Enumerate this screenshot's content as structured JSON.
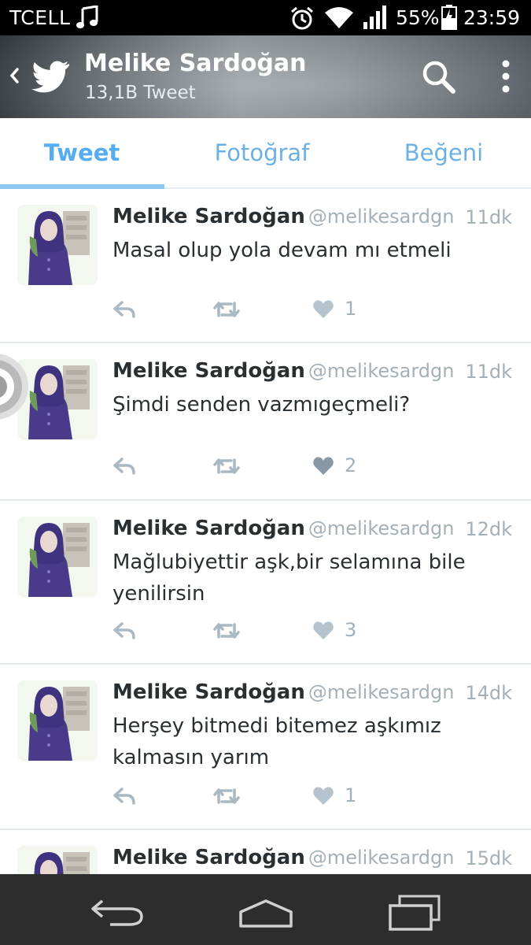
{
  "status_bar": {
    "carrier": "TCELL",
    "battery": "55%",
    "time": "23:59",
    "icons": [
      "music-icon",
      "alarm-icon",
      "wifi-icon",
      "signal-icon",
      "battery-icon"
    ]
  },
  "header": {
    "title": "Melike Sardoğan",
    "subtitle": "13,1B Tweet",
    "icons": [
      "back-chevron-icon",
      "twitter-bird-icon",
      "search-icon",
      "overflow-menu-icon"
    ]
  },
  "tabs": [
    {
      "label": "Tweet",
      "active": true
    },
    {
      "label": "Fotoğraf",
      "active": false
    },
    {
      "label": "Beğeni",
      "active": false
    }
  ],
  "tweets": [
    {
      "name": "Melike Sardoğan",
      "handle": "@melikesardgn",
      "time": "11dk",
      "text": "Masal olup yola devam mı etmeli",
      "likes": "1",
      "liked": false
    },
    {
      "name": "Melike Sardoğan",
      "handle": "@melikesardgn",
      "time": "11dk",
      "text": "Şimdi senden vazmıgeçmeli?",
      "likes": "2",
      "liked": true
    },
    {
      "name": "Melike Sardoğan",
      "handle": "@melikesardgn",
      "time": "12dk",
      "text": "Mağlubiyettir aşk,bir selamına bile yenilirsin",
      "likes": "3",
      "liked": false
    },
    {
      "name": "Melike Sardoğan",
      "handle": "@melikesardgn",
      "time": "14dk",
      "text": "Herşey bitmedi bitemez aşkımız kalmasın yarım",
      "likes": "1",
      "liked": false
    },
    {
      "name": "Melike Sardoğan",
      "handle": "@melikesardgn",
      "time": "15dk",
      "text": "",
      "likes": "",
      "liked": false
    }
  ],
  "colors": {
    "accent": "#55acee",
    "text": "#292f33",
    "muted": "#a4b0b8",
    "action_icon": "#aab8c2",
    "liked_heart": "#8899a6"
  }
}
